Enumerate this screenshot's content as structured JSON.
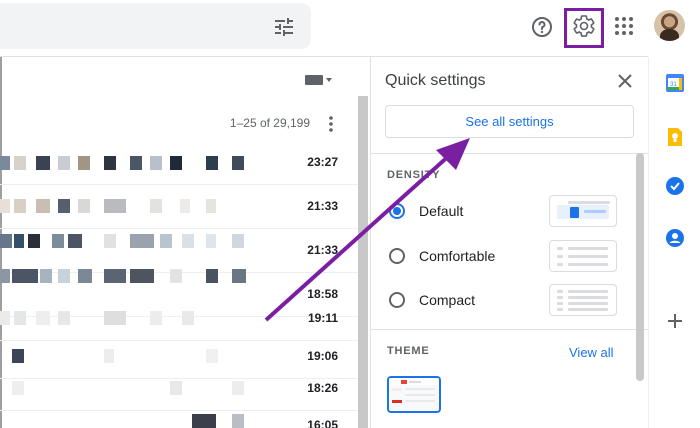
{
  "header": {
    "search_options_icon": "tune-icon",
    "help_icon": "help-icon",
    "settings_icon": "gear-icon",
    "apps_icon": "apps-grid-icon",
    "account_avatar": "avatar",
    "highlight_color": "#7b1fa2"
  },
  "mail_list": {
    "pagination": "1–25 of 29,199",
    "rows": [
      {
        "time": "23:27"
      },
      {
        "time": "21:33"
      },
      {
        "time": "21:33"
      },
      {
        "time": "18:58"
      },
      {
        "time": "19:11"
      },
      {
        "time": "19:06"
      },
      {
        "time": "18:26"
      },
      {
        "time": "16:05"
      }
    ]
  },
  "quick_settings": {
    "title": "Quick settings",
    "see_all_label": "See all settings",
    "density": {
      "label": "DENSITY",
      "options": [
        {
          "label": "Default",
          "selected": true
        },
        {
          "label": "Comfortable",
          "selected": false
        },
        {
          "label": "Compact",
          "selected": false
        }
      ]
    },
    "theme": {
      "label": "THEME",
      "view_all_label": "View all"
    }
  },
  "addons": [
    "calendar-icon",
    "keep-icon",
    "tasks-icon",
    "contacts-icon",
    "add-icon"
  ],
  "colors": {
    "accent": "#1a73e8",
    "annotation": "#7b1fa2"
  }
}
